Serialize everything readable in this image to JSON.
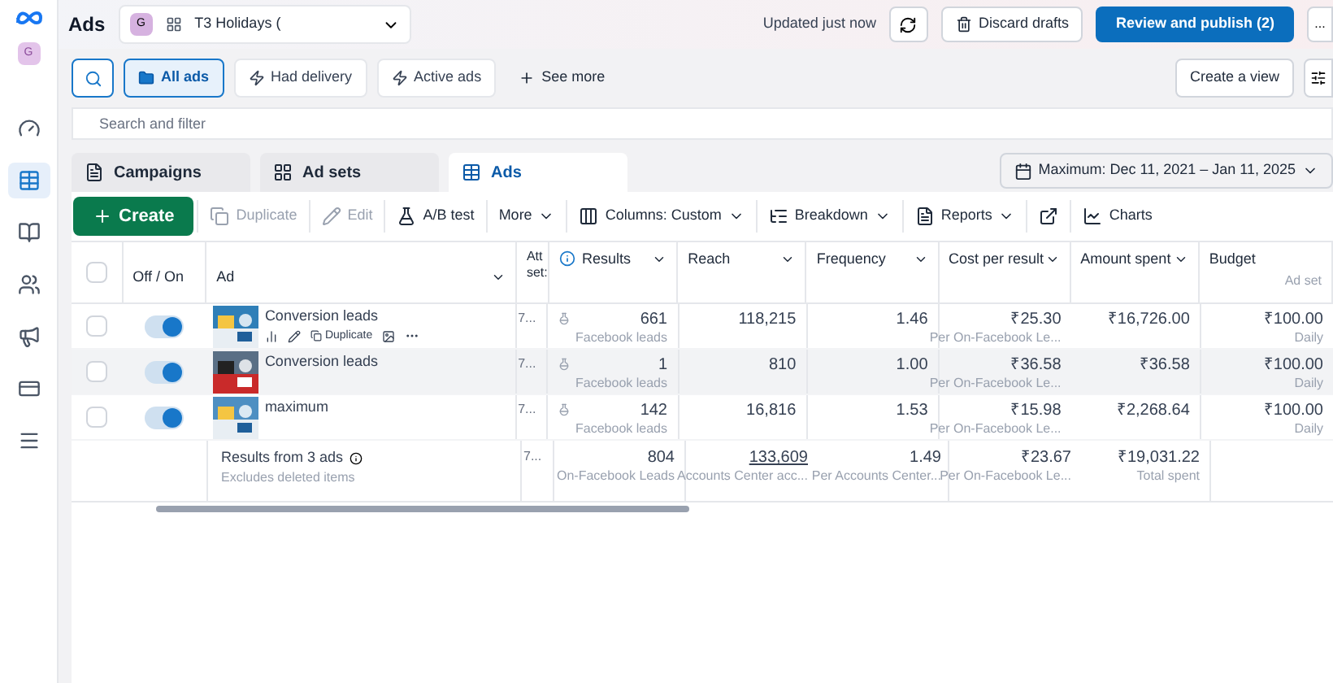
{
  "app_title": "Ads",
  "account": {
    "avatar": "G",
    "name": "T3 Holidays ("
  },
  "sidebar": {
    "avatar": "G",
    "items": [
      {
        "selected": false
      },
      {
        "selected": true
      },
      {
        "selected": false
      },
      {
        "selected": false
      },
      {
        "selected": false
      },
      {
        "selected": false
      },
      {
        "selected": false
      }
    ]
  },
  "header": {
    "updated": "Updated just now",
    "discard": "Discard drafts",
    "publish": "Review and publish (2)",
    "more": "..."
  },
  "filters": [
    {
      "label": "All ads",
      "selected": true
    },
    {
      "label": "Had delivery",
      "selected": false
    },
    {
      "label": "Active ads",
      "selected": false
    }
  ],
  "see_more": "See more",
  "create_view": "Create a view",
  "search": {
    "placeholder": "Search and filter"
  },
  "tabs": [
    {
      "label": "Campaigns",
      "selected": false
    },
    {
      "label": "Ad sets",
      "selected": false
    },
    {
      "label": "Ads",
      "selected": true
    }
  ],
  "date_range": "Maximum: Dec 11, 2021 – Jan 11, 2025",
  "toolbar": [
    {
      "label": "Create",
      "kind": "primary",
      "disabled": false
    },
    {
      "label": "Duplicate",
      "kind": "plain",
      "disabled": true
    },
    {
      "label": "Edit",
      "kind": "plain",
      "disabled": true
    },
    {
      "label": "A/B test",
      "kind": "plain",
      "disabled": false
    },
    {
      "label": "More",
      "kind": "menu",
      "disabled": false
    },
    {
      "label": "Columns: Custom",
      "kind": "menu",
      "disabled": false
    },
    {
      "label": "Breakdown",
      "kind": "menu",
      "disabled": false
    },
    {
      "label": "Reports",
      "kind": "menu",
      "disabled": false
    },
    {
      "kind": "export",
      "disabled": false
    },
    {
      "label": "Charts",
      "kind": "plain",
      "disabled": false
    }
  ],
  "table": {
    "header_checked": false,
    "columns": [
      {
        "label": "Off / On"
      },
      {
        "label": "Ad"
      },
      {
        "label": "Att set:"
      },
      {
        "label": "Results"
      },
      {
        "label": "Reach"
      },
      {
        "label": "Frequency"
      },
      {
        "label": "Cost per result"
      },
      {
        "label": "Amount spent"
      },
      {
        "label": "Budget",
        "sub": "Ad set"
      }
    ],
    "rows": [
      {
        "checked": false,
        "on": true,
        "hovered": false,
        "name": "Conversion leads",
        "actions": "Duplicate",
        "att": "7...",
        "results": "661",
        "results_sub": "Facebook leads",
        "reach": "118,215",
        "frequency": "1.46",
        "cost": "₹25.30",
        "cost_sub": "Per On-Facebook Le...",
        "spent": "₹16,726.00",
        "budget": "₹100.00",
        "budget_sub": "Daily"
      },
      {
        "checked": false,
        "on": true,
        "hovered": true,
        "name": "Conversion leads",
        "att": "7...",
        "results": "1",
        "results_sub": "Facebook leads",
        "reach": "810",
        "frequency": "1.00",
        "cost": "₹36.58",
        "cost_sub": "Per On-Facebook Le...",
        "spent": "₹36.58",
        "budget": "₹100.00",
        "budget_sub": "Daily"
      },
      {
        "checked": false,
        "on": true,
        "hovered": false,
        "name": "maximum",
        "att": "7...",
        "results": "142",
        "results_sub": "Facebook leads",
        "reach": "16,816",
        "frequency": "1.53",
        "cost": "₹15.98",
        "cost_sub": "Per On-Facebook Le...",
        "spent": "₹2,268.64",
        "budget": "₹100.00",
        "budget_sub": "Daily"
      }
    ],
    "summary": {
      "label": "Results from 3 ads",
      "sub": "Excludes deleted items",
      "att": "7...",
      "results": "804",
      "results_sub": "On-Facebook Leads",
      "reach": "133,609",
      "reach_sub": "Accounts Center acc...",
      "frequency": "1.49",
      "frequency_sub": "Per Accounts Center...",
      "cost": "₹23.67",
      "cost_sub": "Per On-Facebook Le...",
      "spent": "₹19,031.22",
      "spent_sub": "Total spent"
    }
  }
}
